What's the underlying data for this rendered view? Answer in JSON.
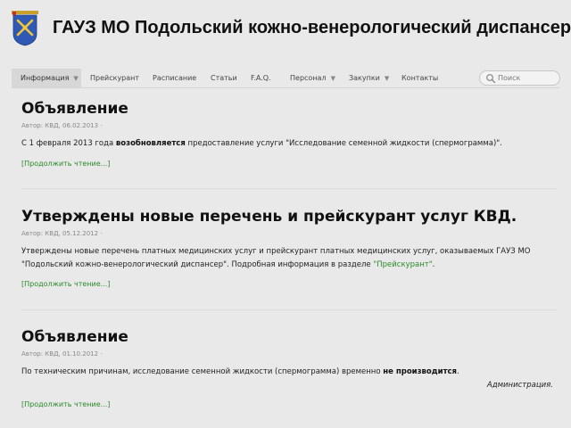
{
  "site": {
    "title": "ГАУЗ МО Подольский кожно-венерологический диспансер"
  },
  "nav": {
    "items": [
      {
        "label": "Информация",
        "dropdown": true,
        "active": true
      },
      {
        "label": "Прейскурант",
        "dropdown": false
      },
      {
        "label": "Расписание",
        "dropdown": false
      },
      {
        "label": "Статьи",
        "dropdown": false
      },
      {
        "label": "F.A.Q.",
        "dropdown": false
      },
      {
        "label": "Персонал",
        "dropdown": true
      },
      {
        "label": "Закупки",
        "dropdown": true
      },
      {
        "label": "Контакты",
        "dropdown": false
      }
    ],
    "search_placeholder": "Поиск"
  },
  "posts": [
    {
      "title": "Объявление",
      "meta": "Автор: КВД, 06.02.2013 ·",
      "body_before": "С 1 февраля 2013 года ",
      "body_bold": "возобновляется",
      "body_after": " предоставление услуги \"Исследование семенной жидкости (спермограмма)\".",
      "read_more": "[Продолжить чтение...]"
    },
    {
      "title": "Утверждены новые перечень и прейскурант услуг КВД.",
      "meta": "Автор: КВД, 05.12.2012 ·",
      "body_line1": "Утверждены новые перечень платных медицинских услуг и прейскурант платных медицинских услуг, оказываемых ГАУЗ МО",
      "body_line2": "\"Подольский кожно-венерологический диспансер\". Подробная информация в разделе ",
      "body_link": "\"Прейскурант\"",
      "body_end": ".",
      "read_more": "[Продолжить чтение...]"
    },
    {
      "title": "Объявление",
      "meta": "Автор: КВД, 01.10.2012 ·",
      "body_before": "По техническим причинам, исследование семенной жидкости (спермограмма) временно ",
      "body_bold": "не производится",
      "body_after": ".",
      "signature": "Администрация.",
      "read_more": "[Продолжить чтение...]"
    }
  ],
  "colors": {
    "background": "#e9e9e9",
    "link": "#2b8a2b",
    "nav_active": "#d7d7d7"
  }
}
